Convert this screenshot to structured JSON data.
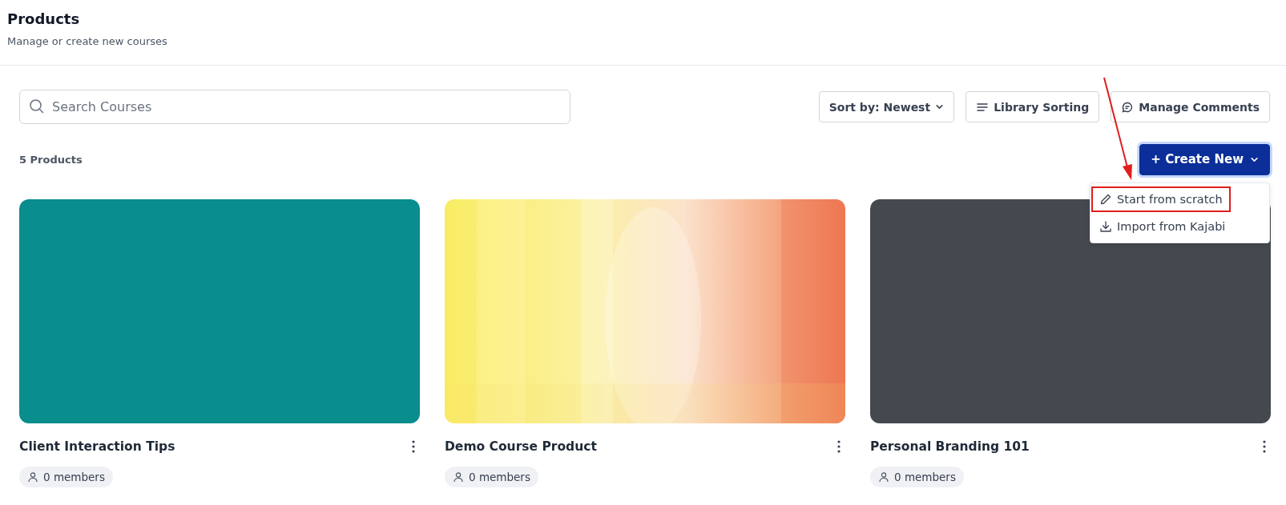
{
  "header": {
    "title": "Products",
    "subtitle": "Manage or create new courses"
  },
  "search": {
    "placeholder": "Search Courses"
  },
  "toolbar": [
    {
      "kind": "sort",
      "label": "Sort by: Newest"
    },
    {
      "kind": "sorting",
      "label": "Library Sorting"
    },
    {
      "kind": "comments",
      "label": "Manage Comments"
    }
  ],
  "count": "5 Products",
  "create_button": {
    "label": "+ Create New",
    "expanded": true
  },
  "create_menu": [
    {
      "kind": "pencil",
      "label": "Start from scratch",
      "highlighted": true
    },
    {
      "kind": "download",
      "label": "Import from Kajabi",
      "highlighted": false
    }
  ],
  "products": [
    {
      "title": "Client Interaction Tips",
      "members": "0 members",
      "cover": {
        "kind": "color",
        "color": "#0a8d8d"
      }
    },
    {
      "title": "Demo Course Product",
      "members": "0 members"
    },
    {
      "title": "Personal Branding 101",
      "members": "0 members",
      "cover": {
        "kind": "color",
        "color": "#45494f"
      }
    }
  ],
  "annotation": {
    "kind": "arrow"
  }
}
